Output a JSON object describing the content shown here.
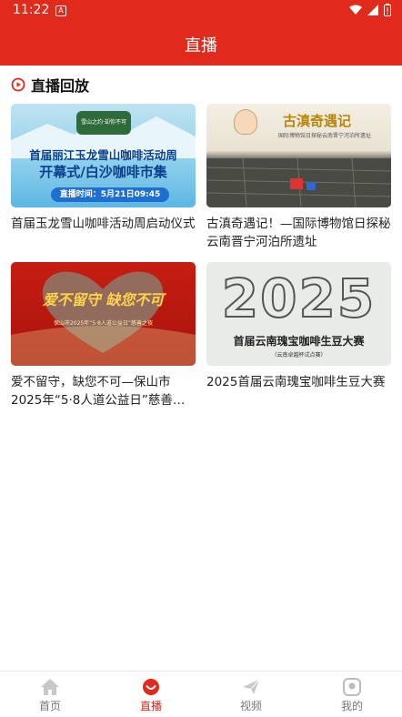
{
  "status_bar": {
    "time": "11:22",
    "notification_icon": "A"
  },
  "header": {
    "title": "直播"
  },
  "section": {
    "title": "直播回放"
  },
  "videos": [
    {
      "title": "首届玉龙雪山咖啡活动周启动仪式",
      "thumb": {
        "badge": "雪山之约·却你不可",
        "line1": "首届丽江玉龙雪山咖啡活动周",
        "line2": "开幕式/白沙咖啡市集",
        "time": "直播时间：5月21日09:45"
      }
    },
    {
      "title": "古滇奇遇记！—国际博物馆日探秘云南晋宁河泊所遗址",
      "thumb": {
        "heading": "古滇奇遇记",
        "sub": "国际博物馆日探秘云南晋宁河泊所遗址"
      }
    },
    {
      "title": "爱不留守，缺您不可—保山市2025年“5·8人道公益日”慈善…",
      "thumb": {
        "heading": "爱不留守 缺您不可",
        "sub": "保山市2025年“5·8人道公益日”慈善之夜"
      }
    },
    {
      "title": "2025首届云南瑰宝咖啡生豆大赛",
      "thumb": {
        "year": "2025",
        "heading": "首届云南瑰宝咖啡生豆大赛",
        "sub": "（云南卓越杯试点赛）"
      }
    }
  ],
  "tabbar": {
    "items": [
      {
        "label": "首页",
        "icon": "home-icon"
      },
      {
        "label": "直播",
        "icon": "live-icon"
      },
      {
        "label": "视频",
        "icon": "send-icon"
      },
      {
        "label": "我的",
        "icon": "profile-icon"
      }
    ],
    "active": 1
  },
  "colors": {
    "brand": "#e02a1c"
  }
}
